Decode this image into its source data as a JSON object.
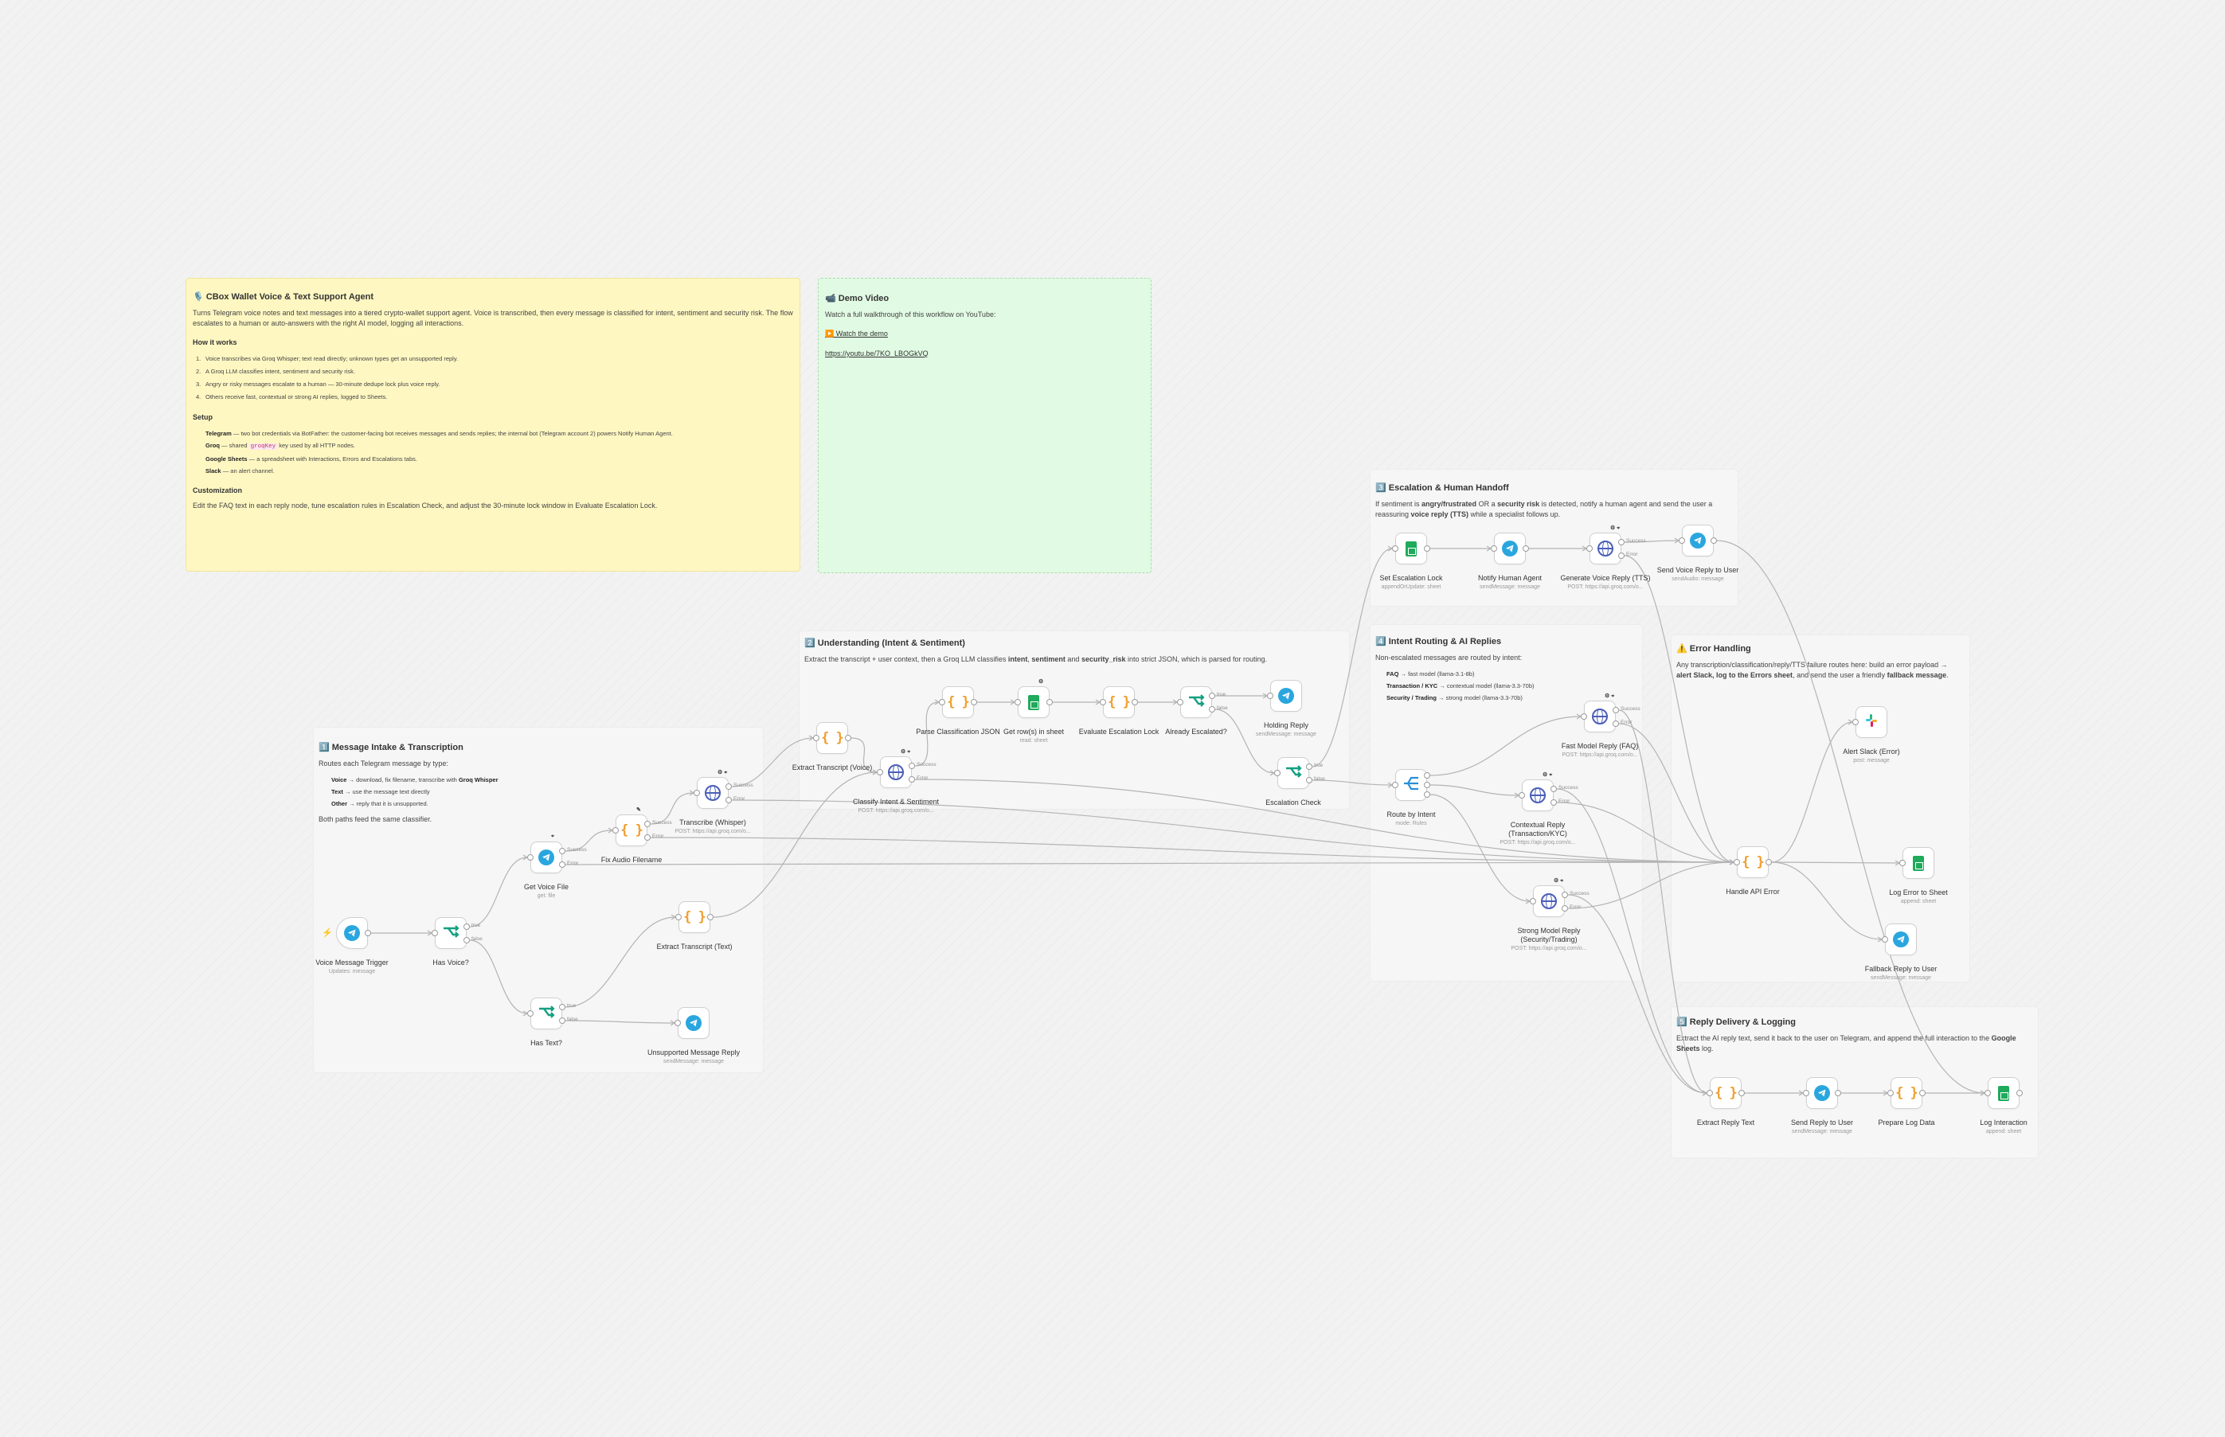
{
  "notes": {
    "main": {
      "title": "🎙️ CBox Wallet Voice & Text Support Agent",
      "intro": "Turns Telegram voice notes and text messages into a tiered crypto-wallet support agent. Voice is transcribed, then every message is classified for intent, sentiment and security risk. The flow escalates to a human or auto-answers with the right AI model, logging all interactions.",
      "how_title": "How it works",
      "how_items": [
        {
          "n": "1.",
          "t": "Voice transcribes via Groq Whisper; text read directly; unknown types get an unsupported reply."
        },
        {
          "n": "2.",
          "t": "A Groq LLM classifies intent, sentiment and security risk."
        },
        {
          "n": "3.",
          "t": "Angry or risky messages escalate to a human — 30-minute dedupe lock plus voice reply."
        },
        {
          "n": "4.",
          "t": "Others receive fast, contextual or strong AI replies, logged to Sheets."
        }
      ],
      "setup_title": "Setup",
      "setup": [
        {
          "k": "Telegram",
          "v": " — two bot credentials via BotFather: the customer-facing bot receives messages and sends replies; the internal bot (Telegram account 2) powers Notify Human Agent."
        },
        {
          "k": "Groq",
          "v": " — shared ",
          "code": "groqKey",
          "v2": " key used by all HTTP nodes."
        },
        {
          "k": "Google Sheets",
          "v": " — a spreadsheet with Interactions, Errors and Escalations tabs."
        },
        {
          "k": "Slack",
          "v": " — an alert channel."
        }
      ],
      "custom_title": "Customization",
      "custom": "Edit the FAQ text in each reply node, tune escalation rules in Escalation Check, and adjust the 30-minute lock window in Evaluate Escalation Lock."
    },
    "demo": {
      "title": "📹 Demo Video",
      "text": "Watch a full walkthrough of this workflow on YouTube:",
      "link": "▶️ Watch the demo",
      "url": "https://youtu.be/7KO_LBOGkVQ"
    },
    "intake": {
      "title": "1️⃣ Message Intake & Transcription",
      "text": "Routes each Telegram message by type:",
      "items": [
        {
          "k": "Voice",
          "v": " → download, fix filename, transcribe with ",
          "b": "Groq Whisper"
        },
        {
          "k": "Text",
          "v": " → use the message text directly"
        },
        {
          "k": "Other",
          "v": " → reply that it is unsupported."
        }
      ],
      "footer": "Both paths feed the same classifier."
    },
    "understanding": {
      "title": "2️⃣ Understanding (Intent & Sentiment)",
      "text_a": "Extract the transcript + user context, then a Groq LLM classifies ",
      "b1": "intent",
      "text_b": ", ",
      "b2": "sentiment",
      "text_c": " and ",
      "b3": "security_risk",
      "text_d": " into strict JSON, which is parsed for routing."
    },
    "escalation": {
      "title": "3️⃣ Escalation & Human Handoff",
      "text_a": "If sentiment is ",
      "b1": "angry/frustrated",
      "text_b": " OR a ",
      "b2": "security risk",
      "text_c": " is detected, notify a human agent and send the user a reassuring ",
      "b3": "voice reply (TTS)",
      "text_d": " while a specialist follows up."
    },
    "routing": {
      "title": "4️⃣ Intent Routing & AI Replies",
      "text": "Non-escalated messages are routed by intent:",
      "items": [
        {
          "k": "FAQ",
          "v": " → fast model (llama-3.1-8b)"
        },
        {
          "k": "Transaction / KYC",
          "v": " → contextual model (llama-3.3-70b)"
        },
        {
          "k": "Security / Trading",
          "v": " → strong model (llama-3.3-70b)"
        }
      ]
    },
    "error": {
      "title": "⚠️ Error Handling",
      "text_a": "Any transcription/classification/reply/TTS failure routes here: build an error payload → ",
      "b1": "alert Slack, log to the Errors sheet",
      "text_b": ", and send the user a friendly ",
      "b2": "fallback message",
      "text_c": "."
    },
    "delivery": {
      "title": "5️⃣ Reply Delivery & Logging",
      "text_a": "Extract the AI reply text, send it back to the user on Telegram, and append the full interaction to the ",
      "b1": "Google Sheets",
      "text_b": " log."
    }
  },
  "nodes": {
    "voice_trigger": {
      "label": "Voice Message Trigger",
      "sub": "Updates: message",
      "icon": "telegram-icon"
    },
    "has_voice": {
      "label": "Has Voice?",
      "sub": "",
      "icon": "if-icon"
    },
    "get_voice_file": {
      "label": "Get Voice File",
      "sub": "get: file",
      "icon": "telegram-icon"
    },
    "fix_audio": {
      "label": "Fix Audio Filename",
      "sub": "",
      "icon": "code-icon"
    },
    "transcribe": {
      "label": "Transcribe (Whisper)",
      "sub": "POST: https://api.groq.com/o...",
      "icon": "http-icon"
    },
    "has_text": {
      "label": "Has Text?",
      "sub": "",
      "icon": "if-icon"
    },
    "extract_text": {
      "label": "Extract Transcript (Text)",
      "sub": "",
      "icon": "code-icon"
    },
    "unsupported": {
      "label": "Unsupported Message Reply",
      "sub": "sendMessage: message",
      "icon": "telegram-icon"
    },
    "extract_voice": {
      "label": "Extract Transcript (Voice)",
      "sub": "",
      "icon": "code-icon"
    },
    "classify": {
      "label": "Classify Intent & Sentiment",
      "sub": "POST: https://api.groq.com/o...",
      "icon": "http-icon"
    },
    "parse_json": {
      "label": "Parse Classification JSON",
      "sub": "",
      "icon": "code-icon"
    },
    "get_rows": {
      "label": "Get row(s) in sheet",
      "sub": "read: sheet",
      "icon": "sheets-icon"
    },
    "eval_lock": {
      "label": "Evaluate Escalation Lock",
      "sub": "",
      "icon": "code-icon"
    },
    "already_esc": {
      "label": "Already Escalated?",
      "sub": "",
      "icon": "if-icon"
    },
    "holding_reply": {
      "label": "Holding Reply",
      "sub": "sendMessage: message",
      "icon": "telegram-icon"
    },
    "esc_check": {
      "label": "Escalation Check",
      "sub": "",
      "icon": "if-icon"
    },
    "set_lock": {
      "label": "Set Escalation Lock",
      "sub": "appendOrUpdate: sheet",
      "icon": "sheets-icon"
    },
    "notify_human": {
      "label": "Notify Human Agent",
      "sub": "sendMessage: message",
      "icon": "telegram-icon"
    },
    "gen_voice": {
      "label": "Generate Voice Reply (TTS)",
      "sub": "POST: https://api.groq.com/o...",
      "icon": "http-icon"
    },
    "send_voice": {
      "label": "Send Voice Reply to User",
      "sub": "sendAudio: message",
      "icon": "telegram-icon"
    },
    "route_intent": {
      "label": "Route by Intent",
      "sub": "mode: Rules",
      "icon": "switch-icon"
    },
    "fast_reply": {
      "label": "Fast Model Reply (FAQ)",
      "sub": "POST: https://api.groq.com/o...",
      "icon": "http-icon"
    },
    "ctx_reply": {
      "label": "Contextual Reply (Transaction/KYC)",
      "sub": "POST: https://api.groq.com/o...",
      "icon": "http-icon"
    },
    "strong_reply": {
      "label": "Strong Model Reply (Security/Trading)",
      "sub": "POST: https://api.groq.com/o...",
      "icon": "http-icon"
    },
    "handle_err": {
      "label": "Handle API Error",
      "sub": "",
      "icon": "code-icon"
    },
    "alert_slack": {
      "label": "Alert Slack (Error)",
      "sub": "post: message",
      "icon": "slack-icon"
    },
    "log_error": {
      "label": "Log Error to Sheet",
      "sub": "append: sheet",
      "icon": "sheets-icon"
    },
    "fallback": {
      "label": "Fallback Reply to User",
      "sub": "sendMessage: message",
      "icon": "telegram-icon"
    },
    "extract_reply": {
      "label": "Extract Reply Text",
      "sub": "",
      "icon": "code-icon"
    },
    "send_reply": {
      "label": "Send Reply to User",
      "sub": "sendMessage: message",
      "icon": "telegram-icon"
    },
    "prepare_log": {
      "label": "Prepare Log Data",
      "sub": "",
      "icon": "code-icon"
    },
    "log_interaction": {
      "label": "Log Interaction",
      "sub": "append: sheet",
      "icon": "sheets-icon"
    }
  },
  "ports": {
    "true": "true",
    "false": "false",
    "success": "Success",
    "error": "Error"
  },
  "colors": {
    "telegram": "#2aa6df",
    "code": "#f19d2b",
    "sheets": "#1faa5c",
    "http": "#4b5fb8",
    "if": "#14a082",
    "trigger_bolt": "#ff6d3a",
    "edge": "#b4b4b4"
  }
}
